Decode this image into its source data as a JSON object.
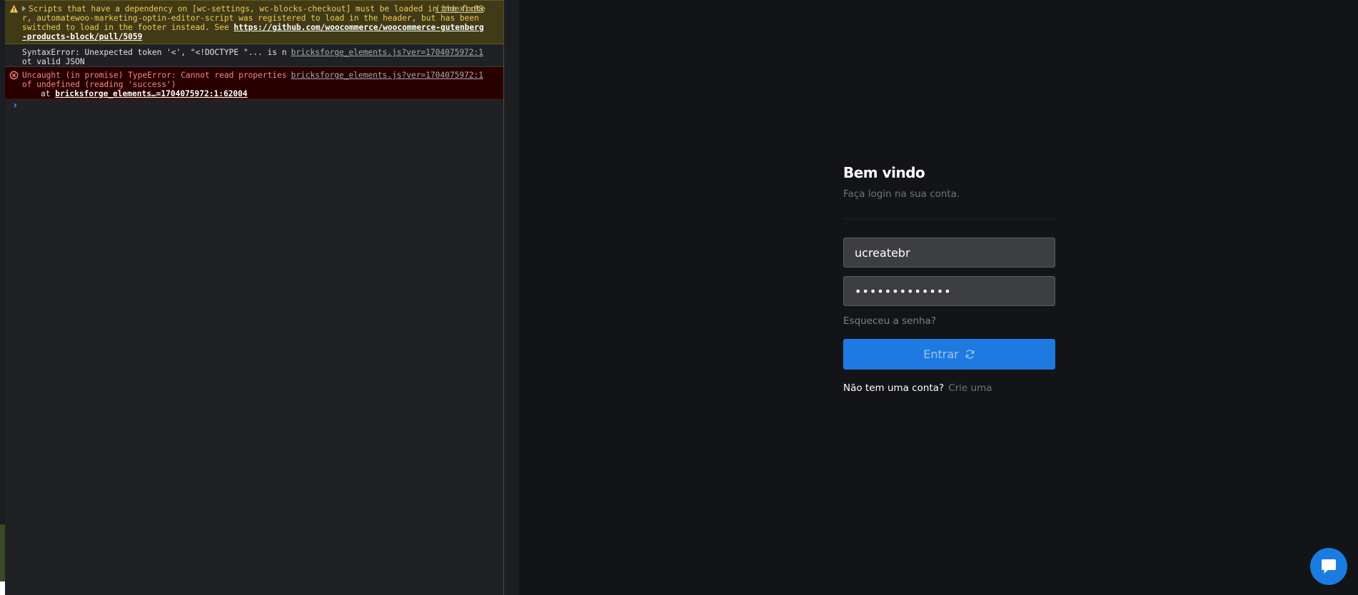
{
  "console": {
    "messages": [
      {
        "level": "warning",
        "text": "Scripts that have a dependency on [wc-settings, wc-blocks-checkout] must be loaded in the footer, automatewoo-marketing-optin-editor-script was registered to load in the header, but has been switched to load in the footer instead. See ",
        "link": "https://github.com/woocommerce/woocommerce-gutenberg-products-block/pull/5059",
        "source": "(index):88"
      },
      {
        "level": "info",
        "text": "SyntaxError: Unexpected token '<', \"<!DOCTYPE \"... is not valid JSON",
        "source": "bricksforge_elements.js?ver=1704075972:1"
      },
      {
        "level": "error",
        "text": "Uncaught (in promise) TypeError: Cannot read properties of undefined (reading 'success')",
        "stack_prefix": "at ",
        "stack_link": "bricksforge_elements…=1704075972:1:62004",
        "source": "bricksforge_elements.js?ver=1704075972:1"
      }
    ],
    "prompt_symbol": "›"
  },
  "login": {
    "title": "Bem vindo",
    "subtitle": "Faça login na sua conta.",
    "username_value": "ucreatebr",
    "password_value": "•••••••••••••",
    "forgot_label": "Esqueceu a senha?",
    "submit_label": "Entrar",
    "signup_prompt": "Não tem uma conta?",
    "signup_link": "Crie uma"
  },
  "colors": {
    "accent": "#1e7ae0",
    "background": "#121418",
    "console_warning_bg": "#413a16",
    "console_error_bg": "#290000"
  },
  "icons": {
    "warning": "warning-icon",
    "error": "error-icon",
    "submit": "refresh-icon",
    "chat": "chat-icon"
  }
}
